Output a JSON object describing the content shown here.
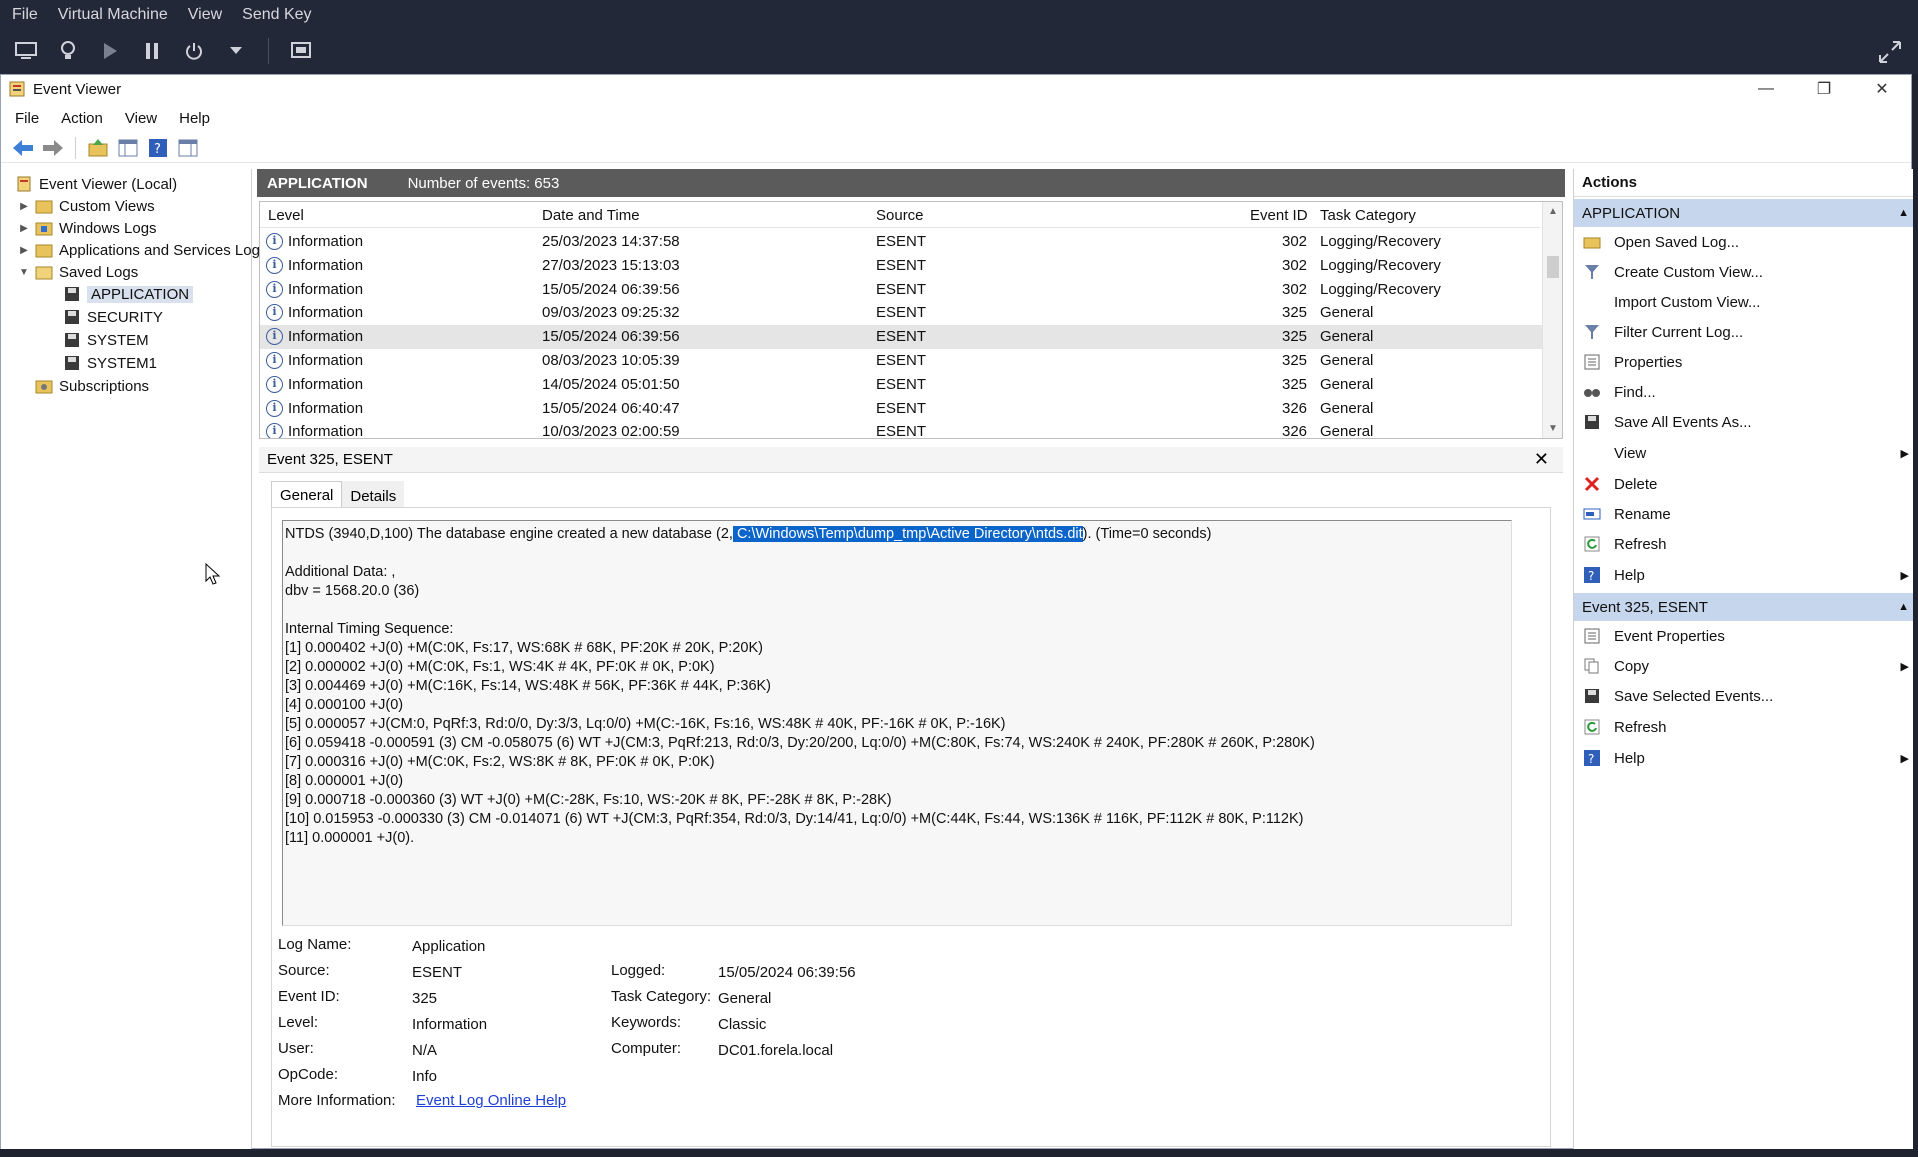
{
  "host": {
    "menu": [
      "File",
      "Virtual Machine",
      "View",
      "Send Key"
    ]
  },
  "window": {
    "title": "Event Viewer"
  },
  "menubar": [
    "File",
    "Action",
    "View",
    "Help"
  ],
  "tree": {
    "root": "Event Viewer (Local)",
    "custom_views": "Custom Views",
    "windows_logs": "Windows Logs",
    "apps_services": "Applications and Services Logs",
    "saved_logs": "Saved Logs",
    "saved": [
      "APPLICATION",
      "SECURITY",
      "SYSTEM",
      "SYSTEM1"
    ],
    "subscriptions": "Subscriptions"
  },
  "list": {
    "name": "APPLICATION",
    "count_label": "Number of events: 653",
    "columns": [
      "Level",
      "Date and Time",
      "Source",
      "Event ID",
      "Task Category"
    ],
    "rows": [
      [
        "Information",
        "25/03/2023 14:37:58",
        "ESENT",
        "302",
        "Logging/Recovery"
      ],
      [
        "Information",
        "27/03/2023 15:13:03",
        "ESENT",
        "302",
        "Logging/Recovery"
      ],
      [
        "Information",
        "15/05/2024 06:39:56",
        "ESENT",
        "302",
        "Logging/Recovery"
      ],
      [
        "Information",
        "09/03/2023 09:25:32",
        "ESENT",
        "325",
        "General"
      ],
      [
        "Information",
        "15/05/2024 06:39:56",
        "ESENT",
        "325",
        "General"
      ],
      [
        "Information",
        "08/03/2023 10:05:39",
        "ESENT",
        "325",
        "General"
      ],
      [
        "Information",
        "14/05/2024 05:01:50",
        "ESENT",
        "325",
        "General"
      ],
      [
        "Information",
        "15/05/2024 06:40:47",
        "ESENT",
        "326",
        "General"
      ],
      [
        "Information",
        "10/03/2023 02:00:59",
        "ESENT",
        "326",
        "General"
      ]
    ]
  },
  "detail": {
    "title": "Event 325, ESENT",
    "tabs": [
      "General",
      "Details"
    ],
    "msg_prefix": "NTDS (3940,D,100) The database engine created a new database (2,",
    "msg_selected": " C:\\Windows\\Temp\\dump_tmp\\Active Directory\\ntds.dit",
    "msg_suffix": "). (Time=0 seconds)",
    "lines": [
      "",
      "Additional Data: ,",
      "dbv = 1568.20.0 (36)",
      "",
      "Internal Timing Sequence:",
      "[1] 0.000402 +J(0) +M(C:0K, Fs:17, WS:68K # 68K, PF:20K # 20K, P:20K)",
      "[2] 0.000002 +J(0) +M(C:0K, Fs:1, WS:4K # 4K, PF:0K # 0K, P:0K)",
      "[3] 0.004469 +J(0) +M(C:16K, Fs:14, WS:48K # 56K, PF:36K # 44K, P:36K)",
      "[4] 0.000100 +J(0)",
      "[5] 0.000057 +J(CM:0, PqRf:3, Rd:0/0, Dy:3/3, Lq:0/0) +M(C:-16K, Fs:16, WS:48K # 40K, PF:-16K # 0K, P:-16K)",
      "[6] 0.059418 -0.000591 (3) CM -0.058075 (6) WT +J(CM:3, PqRf:213, Rd:0/3, Dy:20/200, Lq:0/0) +M(C:80K, Fs:74, WS:240K # 240K, PF:280K # 260K, P:280K)",
      "[7] 0.000316 +J(0) +M(C:0K, Fs:2, WS:8K # 8K, PF:0K # 0K, P:0K)",
      "[8] 0.000001 +J(0)",
      "[9] 0.000718 -0.000360 (3) WT +J(0) +M(C:-28K, Fs:10, WS:-20K # 8K, PF:-28K # 8K, P:-28K)",
      "[10] 0.015953 -0.000330 (3) CM -0.014071 (6) WT +J(CM:3, PqRf:354, Rd:0/3, Dy:14/41, Lq:0/0) +M(C:44K, Fs:44, WS:136K # 116K, PF:112K # 80K, P:112K)",
      "[11] 0.000001 +J(0)."
    ],
    "props": {
      "log_name_l": "Log Name:",
      "log_name": "Application",
      "source_l": "Source:",
      "source": "ESENT",
      "logged_l": "Logged:",
      "logged": "15/05/2024 06:39:56",
      "event_id_l": "Event ID:",
      "event_id": "325",
      "task_l": "Task Category:",
      "task": "General",
      "level_l": "Level:",
      "level": "Information",
      "keywords_l": "Keywords:",
      "keywords": "Classic",
      "user_l": "User:",
      "user": "N/A",
      "computer_l": "Computer:",
      "computer": "DC01.forela.local",
      "opcode_l": "OpCode:",
      "opcode": "Info",
      "more_l": "More Information:",
      "more_link": "Event Log Online Help"
    }
  },
  "actions": {
    "title": "Actions",
    "sec1": "APPLICATION",
    "items1": [
      "Open Saved Log...",
      "Create Custom View...",
      "Import Custom View...",
      "Filter Current Log...",
      "Properties",
      "Find...",
      "Save All Events As...",
      "View",
      "Delete",
      "Rename",
      "Refresh",
      "Help"
    ],
    "sec2": "Event 325, ESENT",
    "items2": [
      "Event Properties",
      "Copy",
      "Save Selected Events...",
      "Refresh",
      "Help"
    ]
  },
  "colors": {
    "selection": "#0a64c9",
    "section_header": "#c6d6ec",
    "list_header": "#5b5b5b",
    "host_bar": "#232838"
  }
}
